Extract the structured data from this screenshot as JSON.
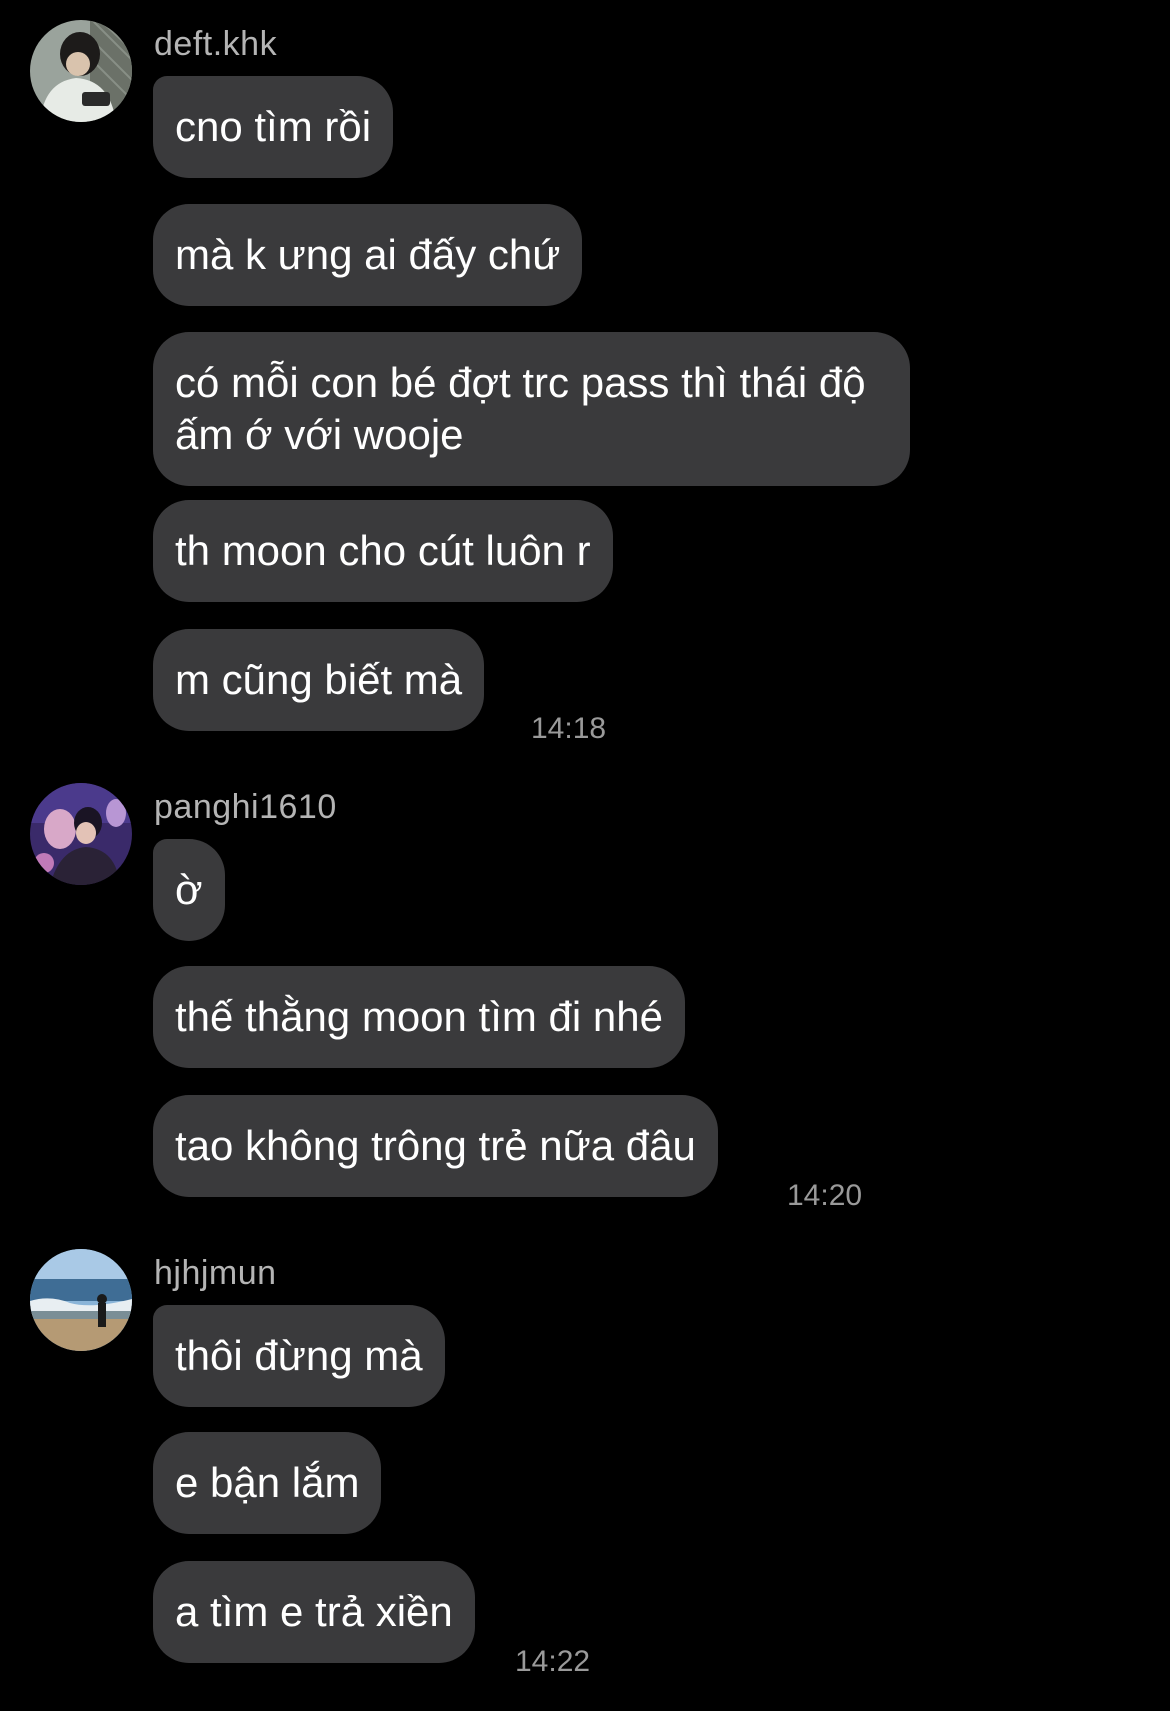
{
  "groups": [
    {
      "username": "deft.khk",
      "avatar": "avatar-deft",
      "messages": [
        "cno tìm rồi",
        "mà k ưng ai đấy chứ",
        "có mỗi con bé đợt trc pass thì thái độ ấm ớ với wooje",
        "th moon cho cút luôn r",
        "m cũng biết mà"
      ],
      "time": "14:18"
    },
    {
      "username": "panghi1610",
      "avatar": "avatar-panghi",
      "messages": [
        "ờ",
        "thế thằng moon tìm đi nhé",
        "tao không trông trẻ nữa đâu"
      ],
      "time": "14:20"
    },
    {
      "username": "hjhjmun",
      "avatar": "avatar-hjhjmun",
      "messages": [
        "thôi đừng mà",
        "e bận lắm",
        "a tìm e trả xiền"
      ],
      "time": "14:22"
    }
  ],
  "colors": {
    "background": "#000000",
    "bubble": "#3a3a3c",
    "text": "#ffffff",
    "meta": "#9a9a9a"
  }
}
